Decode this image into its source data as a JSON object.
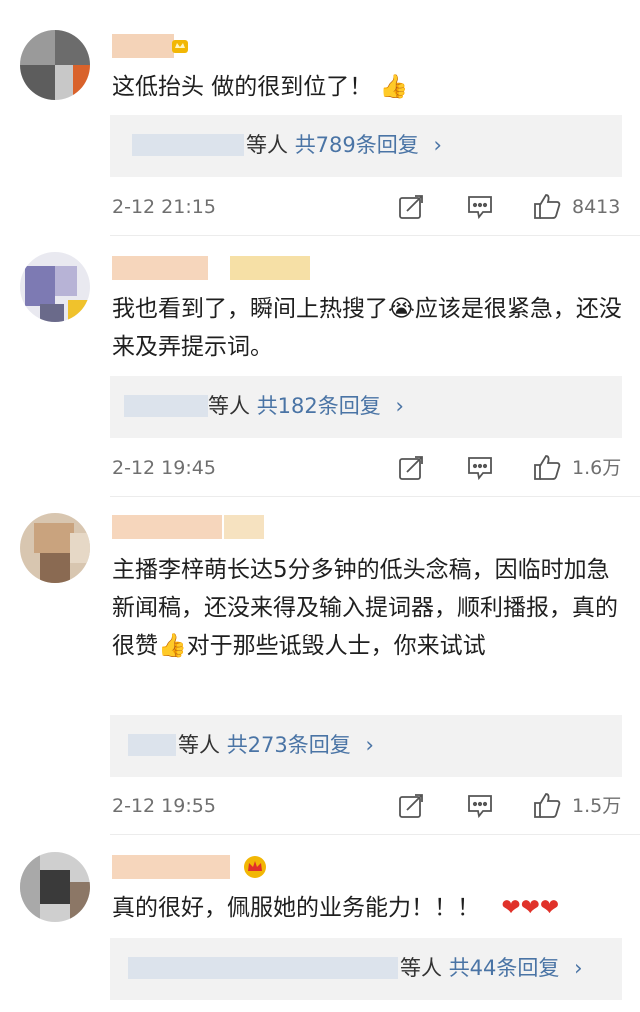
{
  "comments": [
    {
      "text": "这低抬头 做的很到位了！",
      "emoji": "👍",
      "reply_suffix": "等人",
      "reply_count": "共789条回复",
      "reply_chevron": "›",
      "time": "2-12 21:15",
      "likes": "8413"
    },
    {
      "text_a": "我也看到了，瞬间上热搜了",
      "emoji": "😭",
      "text_b": "应该是很紧急，还没来及弄提示词。",
      "reply_suffix": "等人",
      "reply_count": "共182条回复",
      "reply_chevron": "›",
      "time": "2-12 19:45",
      "likes": "1.6万"
    },
    {
      "text_a": "主播李梓萌长达5分多钟的低头念稿，因临时加急新闻稿，还没来得及输入提词器，顺利播报，真的很赞",
      "emoji": "👍",
      "text_b": "对于那些诋毁人士，你来试试",
      "reply_suffix": "等人",
      "reply_count": "共273条回复",
      "reply_chevron": "›",
      "time": "2-12 19:55",
      "likes": "1.5万"
    },
    {
      "text": "真的很好，佩服她的业务能力！！！",
      "emoji": "❤❤❤",
      "reply_suffix": "等人",
      "reply_count": "共44条回复",
      "reply_chevron": "›"
    }
  ],
  "colors": {
    "link": "#4a74a5",
    "meta": "#6f6f6f",
    "reply_bg": "#f2f2f2",
    "heart": "#e0322a"
  },
  "icons": {
    "repost": "repost-icon",
    "comment": "comment-icon",
    "like": "thumbs-up-icon"
  }
}
